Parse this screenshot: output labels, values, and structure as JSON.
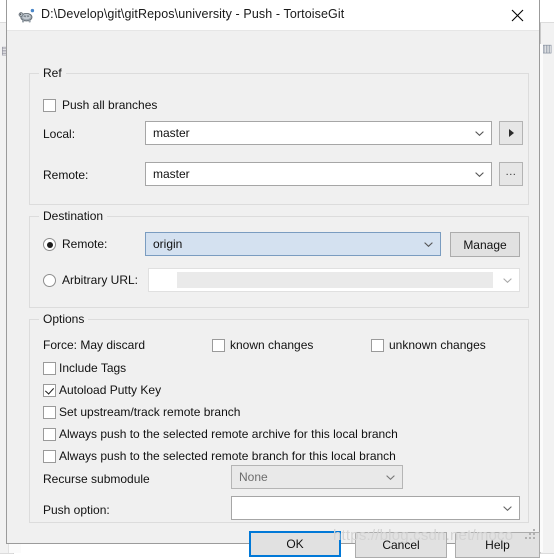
{
  "window": {
    "title": "D:\\Develop\\git\\gitRepos\\university - Push - TortoiseGit",
    "app_icon": "tortoisegit-turtle-icon",
    "close_label": "✕"
  },
  "ref": {
    "group_label": "Ref",
    "push_all_branches": {
      "label": "Push all branches",
      "checked": false
    },
    "local": {
      "label": "Local:",
      "value": "master",
      "browse_button": "▶"
    },
    "remote": {
      "label": "Remote:",
      "value": "master",
      "browse_button": "..."
    }
  },
  "destination": {
    "group_label": "Destination",
    "remote": {
      "label": "Remote:",
      "selected": true,
      "value": "origin"
    },
    "manage_button": "Manage",
    "arbitrary_url": {
      "label": "Arbitrary URL:",
      "selected": false,
      "value": ""
    }
  },
  "options": {
    "group_label": "Options",
    "force_label": "Force: May discard",
    "force_known": {
      "label": "known changes",
      "checked": false
    },
    "force_unknown": {
      "label": "unknown changes",
      "checked": false
    },
    "checkboxes": [
      {
        "label": "Include Tags",
        "checked": false
      },
      {
        "label": "Autoload Putty Key",
        "checked": true
      },
      {
        "label": "Set upstream/track remote branch",
        "checked": false
      },
      {
        "label": "Always push to the selected remote archive for this local branch",
        "checked": false
      },
      {
        "label": "Always push to the selected remote branch for this local branch",
        "checked": false
      }
    ],
    "recurse_submodule": {
      "label": "Recurse submodule",
      "value": "None",
      "enabled": false
    },
    "push_option": {
      "label": "Push option:",
      "value": ""
    }
  },
  "footer": {
    "ok": "OK",
    "cancel": "Cancel",
    "help": "Help"
  },
  "watermark": "https://blog.csdn.net/moco",
  "colors": {
    "accent": "#0078d7",
    "dialog_bg": "#f0f0f0",
    "focused_combo_bg": "#d4e1f0",
    "disabled_combo_bg": "#e9e9e9"
  },
  "background_glyphs": {
    "left": "▤",
    "right": "▥"
  }
}
